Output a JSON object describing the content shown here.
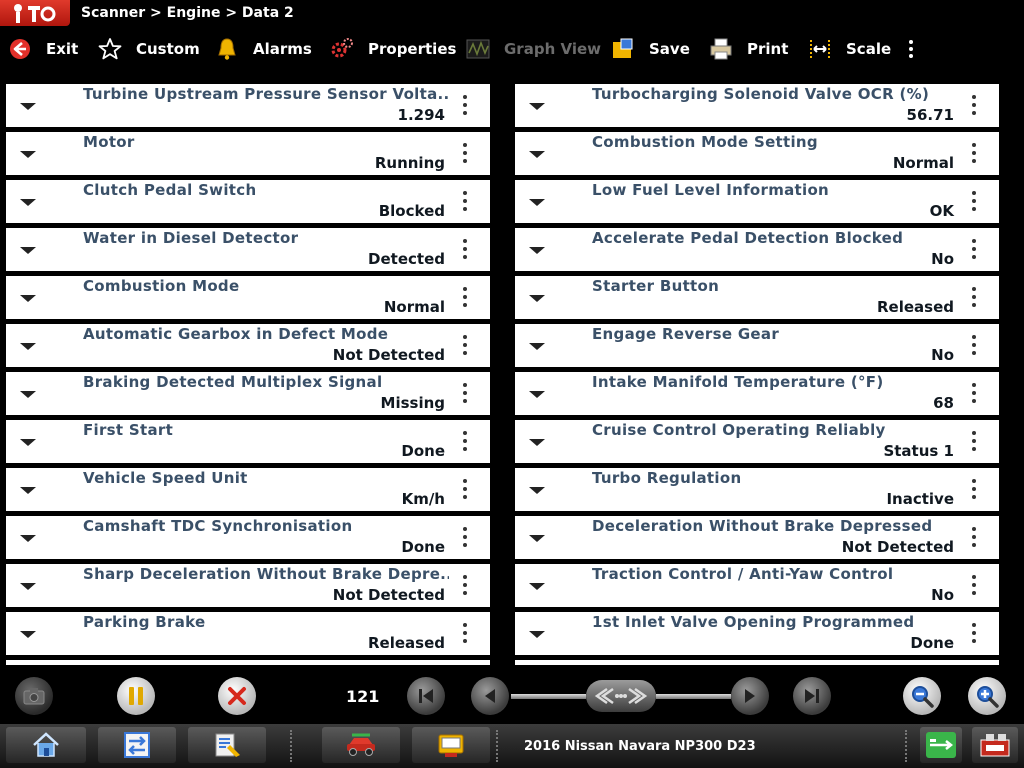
{
  "header": {
    "breadcrumb": "Scanner > Engine > Data 2",
    "logo_icon": "scanner-logo-icon"
  },
  "toolbar": {
    "exit_label": "Exit",
    "custom_label": "Custom",
    "alarms_label": "Alarms",
    "properties_label": "Properties",
    "graph_view_label": "Graph View",
    "save_label": "Save",
    "print_label": "Print",
    "scale_label": "Scale"
  },
  "left_items": [
    {
      "name": "Turbine Upstream Pressure Sensor Volta...",
      "value": "1.294"
    },
    {
      "name": "Motor",
      "value": "Running"
    },
    {
      "name": "Clutch Pedal Switch",
      "value": "Blocked"
    },
    {
      "name": "Water in Diesel Detector",
      "value": "Detected"
    },
    {
      "name": "Combustion Mode",
      "value": "Normal"
    },
    {
      "name": "Automatic Gearbox in Defect Mode",
      "value": "Not Detected"
    },
    {
      "name": "Braking Detected Multiplex Signal",
      "value": "Missing"
    },
    {
      "name": "First Start",
      "value": "Done"
    },
    {
      "name": "Vehicle Speed Unit",
      "value": "Km/h"
    },
    {
      "name": "Camshaft TDC Synchronisation",
      "value": "Done"
    },
    {
      "name": "Sharp Deceleration Without Brake Depre...",
      "value": "Not Detected"
    },
    {
      "name": "Parking Brake",
      "value": "Released"
    },
    {
      "name": "",
      "value": ""
    }
  ],
  "right_items": [
    {
      "name": "Turbocharging Solenoid Valve OCR (%)",
      "value": "56.71"
    },
    {
      "name": "Combustion Mode Setting",
      "value": "Normal"
    },
    {
      "name": "Low Fuel Level Information",
      "value": "OK"
    },
    {
      "name": "Accelerate Pedal Detection Blocked",
      "value": "No"
    },
    {
      "name": "Starter Button",
      "value": "Released"
    },
    {
      "name": "Engage Reverse Gear",
      "value": "No"
    },
    {
      "name": "Intake Manifold Temperature (°F)",
      "value": "68"
    },
    {
      "name": "Cruise Control Operating Reliably",
      "value": "Status 1"
    },
    {
      "name": "Turbo Regulation",
      "value": "Inactive"
    },
    {
      "name": "Deceleration Without Brake Depressed",
      "value": "Not Detected"
    },
    {
      "name": "Traction Control / Anti-Yaw Control",
      "value": "No"
    },
    {
      "name": "1st Inlet Valve Opening Programmed",
      "value": "Done"
    },
    {
      "name": "",
      "value": ""
    }
  ],
  "playback": {
    "frame_counter": "121"
  },
  "taskbar": {
    "vehicle": "2016 Nissan Navara NP300 D23"
  },
  "colors": {
    "accent_red": "#d3281c",
    "row_label": "#3a5068",
    "row_value": "#101820",
    "bell_yellow": "#f0b400"
  }
}
